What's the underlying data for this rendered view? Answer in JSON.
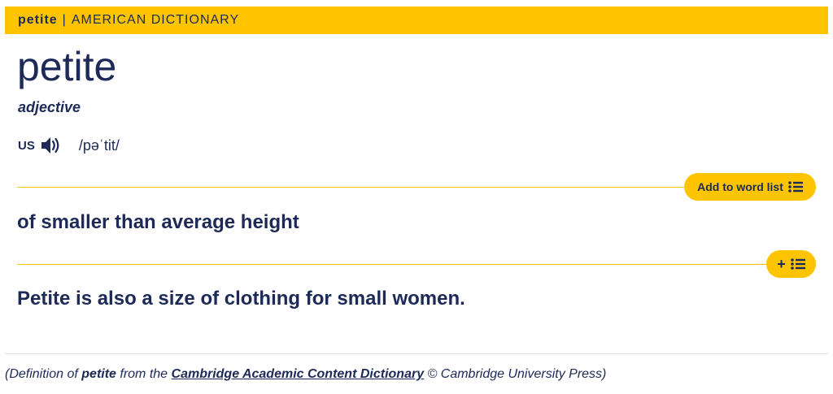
{
  "header": {
    "headword": "petite",
    "separator": "|",
    "dictionary": "AMERICAN DICTIONARY"
  },
  "entry": {
    "headword": "petite",
    "part_of_speech": "adjective",
    "pronunciation": {
      "region": "US",
      "ipa": "/pəˈtit/",
      "audio_icon": "speaker-icon"
    }
  },
  "senses": [
    {
      "definition": "of smaller than average height",
      "button_label": "Add to word list",
      "button_icon": "list-icon"
    },
    {
      "definition": "Petite is also a size of clothing for small women.",
      "button_label": "+",
      "button_icon": "list-icon"
    }
  ],
  "citation": {
    "prefix": "(Definition of ",
    "word": "petite",
    "middle": " from the ",
    "source": "Cambridge Academic Content Dictionary",
    "suffix": " © Cambridge University Press)"
  },
  "colors": {
    "accent": "#fec400",
    "text": "#1d2a57"
  }
}
